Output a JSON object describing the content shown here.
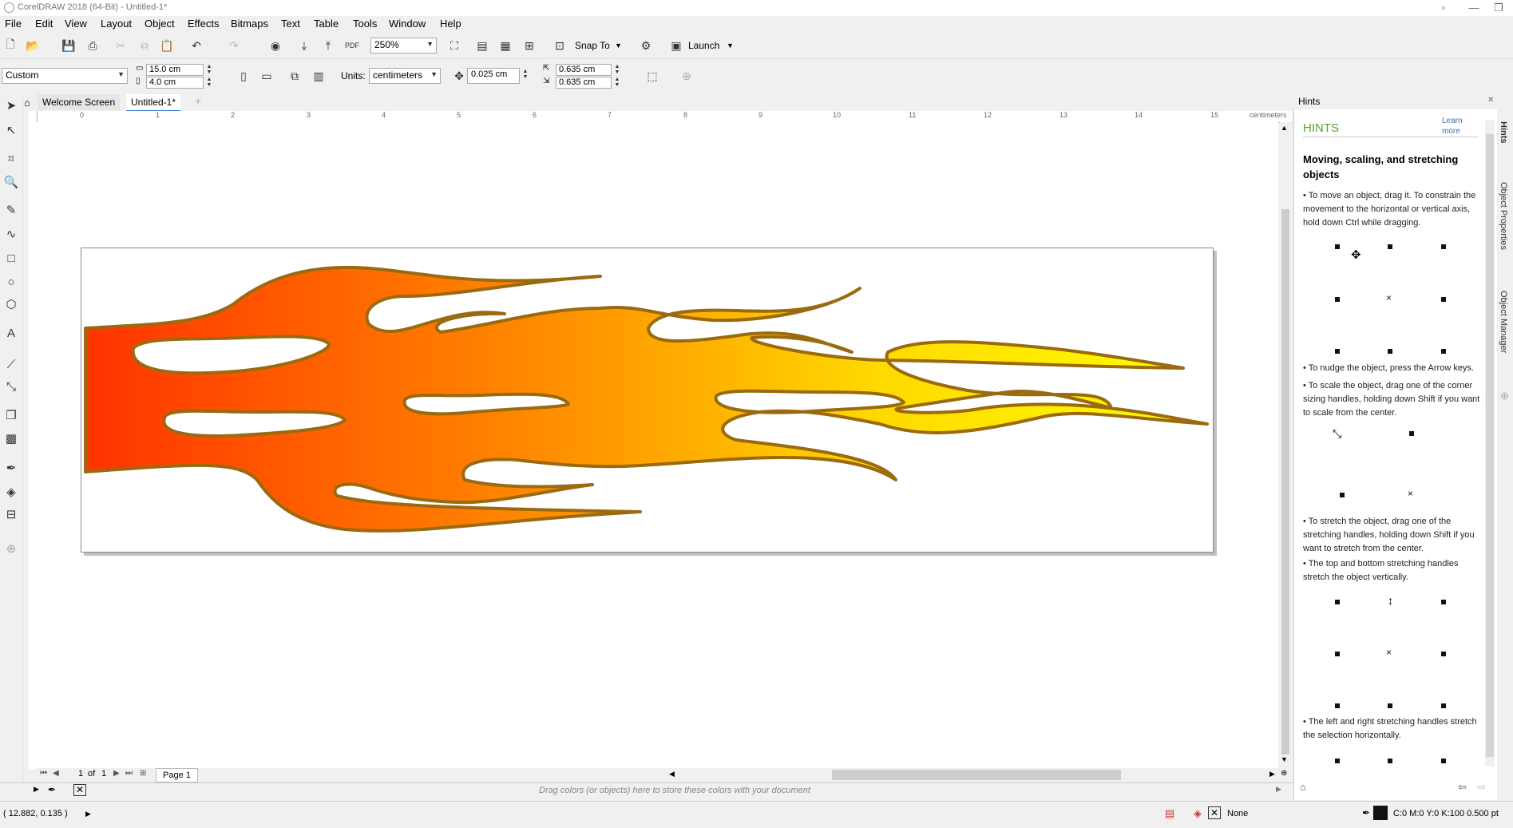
{
  "window": {
    "title": "CorelDRAW 2018 (64-Bit) - Untitled-1*"
  },
  "menu": [
    "File",
    "Edit",
    "View",
    "Layout",
    "Object",
    "Effects",
    "Bitmaps",
    "Text",
    "Table",
    "Tools",
    "Window",
    "Help"
  ],
  "toolbar": {
    "zoom": "250%",
    "snap_to": "Snap To",
    "launch": "Launch"
  },
  "property_bar": {
    "page_preset": "Custom",
    "width": "15.0 cm",
    "height": "4.0 cm",
    "units_label": "Units:",
    "units": "centimeters",
    "nudge": "0.025 cm",
    "dup_x": "0.635 cm",
    "dup_y": "0.635 cm"
  },
  "tabs": {
    "welcome": "Welcome Screen",
    "doc": "Untitled-1*"
  },
  "ruler": {
    "labels": [
      "0",
      "1",
      "2",
      "3",
      "4",
      "5",
      "6",
      "7",
      "8",
      "9",
      "10",
      "11",
      "12",
      "13",
      "14",
      "15"
    ],
    "unit": "centimeters"
  },
  "page_nav": {
    "current": "1",
    "of": "of",
    "total": "1",
    "page_tab": "Page 1"
  },
  "palette_hint": "Drag colors (or objects) here to store these colors with your document",
  "hints_panel": {
    "panel_title": "Hints",
    "header": "HINTS",
    "learn_more_1": "Learn",
    "learn_more_2": "more",
    "title": "Moving, scaling, and stretching objects",
    "p1": "• To move an object, drag it. To constrain the movement to the horizontal or vertical axis, hold down Ctrl while dragging.",
    "p2": "• To nudge the object, press the Arrow keys.",
    "p3": "• To scale the object, drag one of the corner sizing handles, holding down Shift if you want to scale from the center.",
    "p4": "• To stretch the object, drag one of the stretching handles, holding down Shift if you want to stretch from the center.",
    "p5": "• The top and bottom stretching handles stretch the object vertically.",
    "p6": "• The left and right stretching handles stretch the selection horizontally."
  },
  "docker_tabs": [
    "Hints",
    "Object Properties",
    "Object Manager"
  ],
  "status": {
    "coords": "( 12.882, 0.135 )",
    "fill": "None",
    "outline": "C:0 M:0 Y:0 K:100  0.500 pt"
  },
  "colors": {
    "flame_outline": "#9a6a10",
    "flame_red": "#ff3300",
    "flame_orange": "#ff8a00",
    "flame_yellow": "#ffff00",
    "hints_green": "#5aa02c"
  }
}
